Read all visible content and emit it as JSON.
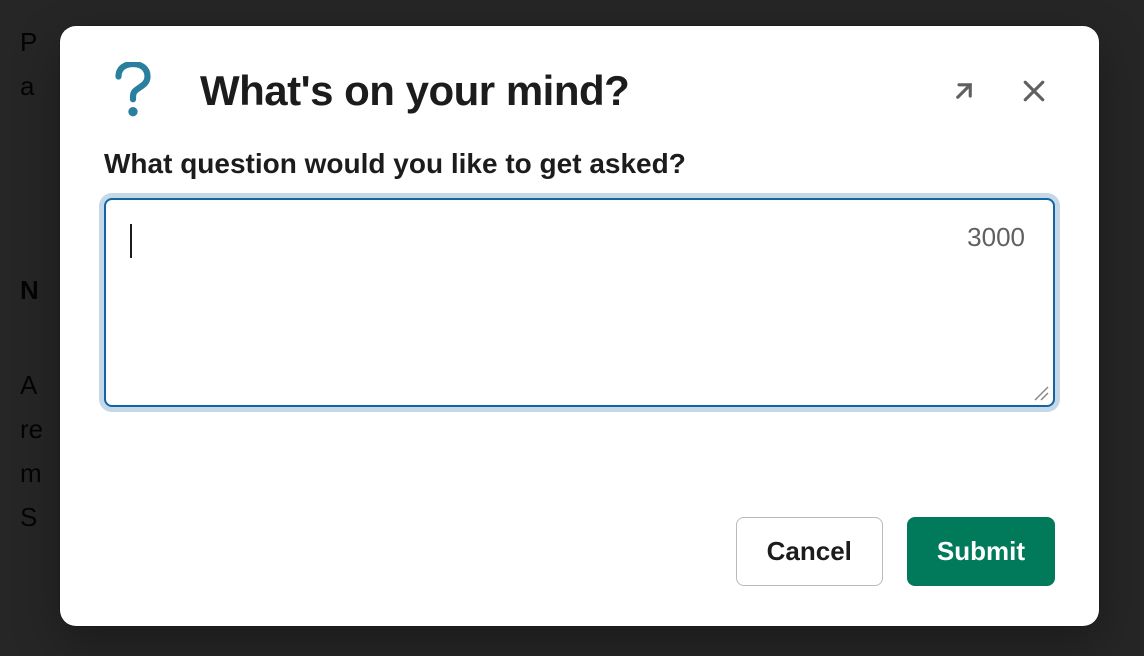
{
  "background": {
    "line1": "P",
    "line2": "a",
    "line3": "N",
    "line4": "A",
    "line5": "re",
    "line6": "m",
    "line7": "S"
  },
  "modal": {
    "title": "What's on your mind?",
    "field_label": "What question would you like to get asked?",
    "textarea_value": "",
    "char_limit": "3000",
    "cancel_label": "Cancel",
    "submit_label": "Submit"
  }
}
